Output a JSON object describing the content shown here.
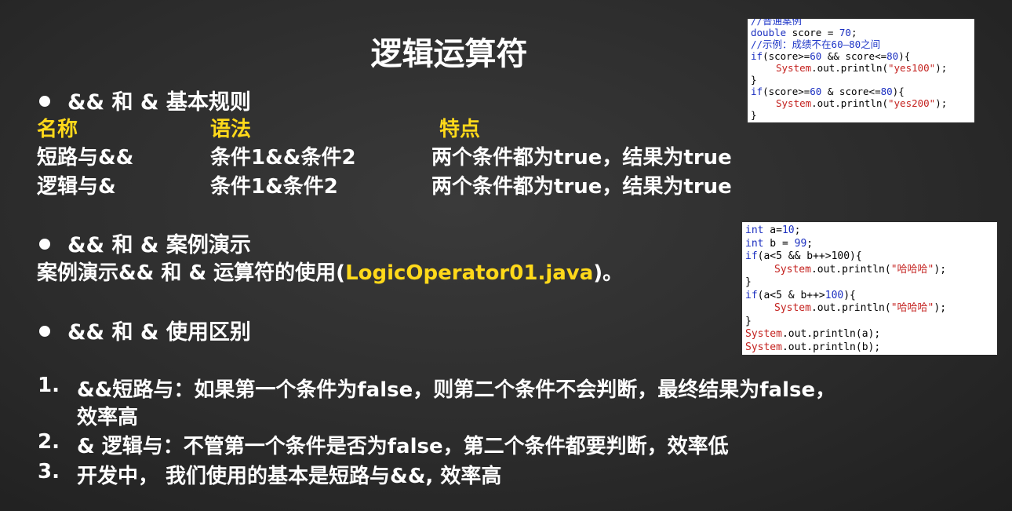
{
  "title": "逻辑运算符",
  "section1": {
    "heading": "&& 和 & 基本规则",
    "columns": {
      "name": "名称",
      "syntax": "语法",
      "feature": "特点"
    },
    "rows": [
      {
        "name": "短路与&&",
        "syntax": "条件1&&条件2",
        "feature": "两个条件都为true，结果为true"
      },
      {
        "name": "逻辑与&",
        "syntax": "条件1&条件2",
        "feature": "两个条件都为true，结果为true"
      }
    ]
  },
  "section2": {
    "heading": "&& 和 & 案例演示",
    "desc_prefix": "案例演示&& 和 & 运算符的使用(",
    "desc_file": "LogicOperator01.java",
    "desc_suffix": ")。"
  },
  "section3": {
    "heading": "&& 和 & 使用区别",
    "items": [
      {
        "num": "1.",
        "line1": "&&短路与：如果第一个条件为false，则第二个条件不会判断，最终结果为false，",
        "line2": "效率高"
      },
      {
        "num": "2.",
        "line1": "& 逻辑与：不管第一个条件是否为false，第二个条件都要判断，效率低"
      },
      {
        "num": "3.",
        "line1": "开发中， 我们使用的基本是短路与&&, 效率高"
      }
    ]
  },
  "code1": {
    "l1": "//普通案例",
    "l2a": "double",
    "l2b": " score = ",
    "l2c": "70",
    "l2d": ";",
    "l3": "//示例：成绩不在60—80之间",
    "l4a": "if",
    "l4b": "(score>=",
    "l4c": "60",
    "l4d": " && score<=",
    "l4e": "80",
    "l4f": "){",
    "l5a": "System",
    "l5b": ".out.println(",
    "l5c": "\"yes100\"",
    "l5d": ");",
    "l6": "}",
    "l7a": "if",
    "l7b": "(score>=",
    "l7c": "60",
    "l7d": " & score<=",
    "l7e": "80",
    "l7f": "){",
    "l8a": "System",
    "l8b": ".out.println(",
    "l8c": "\"yes200\"",
    "l8d": ");",
    "l9": "}"
  },
  "code2": {
    "l1a": "int",
    "l1b": " a=",
    "l1c": "10",
    "l1d": ";",
    "l2a": "int",
    "l2b": " b = ",
    "l2c": "99",
    "l2d": ";",
    "l3a": "if",
    "l3b": "(a<5 && b++>100){",
    "l4a": "System",
    "l4b": ".out.println(",
    "l4c": "\"哈哈哈\"",
    "l4d": ");",
    "l5": "}",
    "l6a": "if",
    "l6b": "(a<5 & b++>",
    "l6c": "100",
    "l6d": "){",
    "l7a": "System",
    "l7b": ".out.println(",
    "l7c": "\"哈哈哈\"",
    "l7d": ");",
    "l8": "}",
    "l9a": "System",
    "l9b": ".out.println(a);",
    "l10a": "System",
    "l10b": ".out.println(b);"
  }
}
